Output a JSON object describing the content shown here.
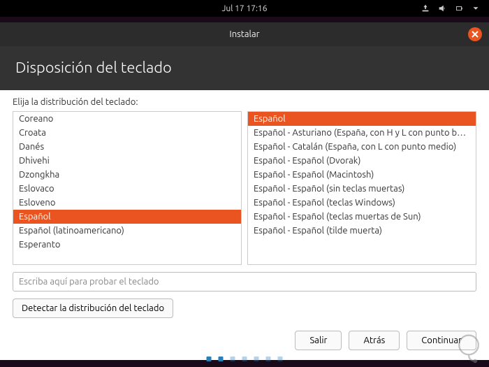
{
  "topbar": {
    "datetime": "Jul 17  17:16"
  },
  "window": {
    "title": "Instalar"
  },
  "header": {
    "title": "Disposición del teclado"
  },
  "prompt": "Elija la distribución del teclado:",
  "left_list": {
    "items": [
      "Coreano",
      "Croata",
      "Danés",
      "Dhivehi",
      "Dzongkha",
      "Eslovaco",
      "Esloveno",
      "Español",
      "Español (latinoamericano)",
      "Esperanto"
    ],
    "selected_index": 7
  },
  "right_list": {
    "items": [
      "Español",
      "Español - Asturiano (España, con H y L con punto bajo)",
      "Español - Catalán (España, con L con punto medio)",
      "Español - Español (Dvorak)",
      "Español - Español (Macintosh)",
      "Español - Español (sin teclas muertas)",
      "Español - Español (teclas Windows)",
      "Español - Español (teclas muertas de Sun)",
      "Español - Español (tilde muerta)"
    ],
    "selected_index": 0
  },
  "test_input": {
    "placeholder": "Escriba aquí para probar el teclado"
  },
  "buttons": {
    "detect": "Detectar la distribución del teclado",
    "quit": "Salir",
    "back": "Atrás",
    "continue": "Continuar"
  }
}
